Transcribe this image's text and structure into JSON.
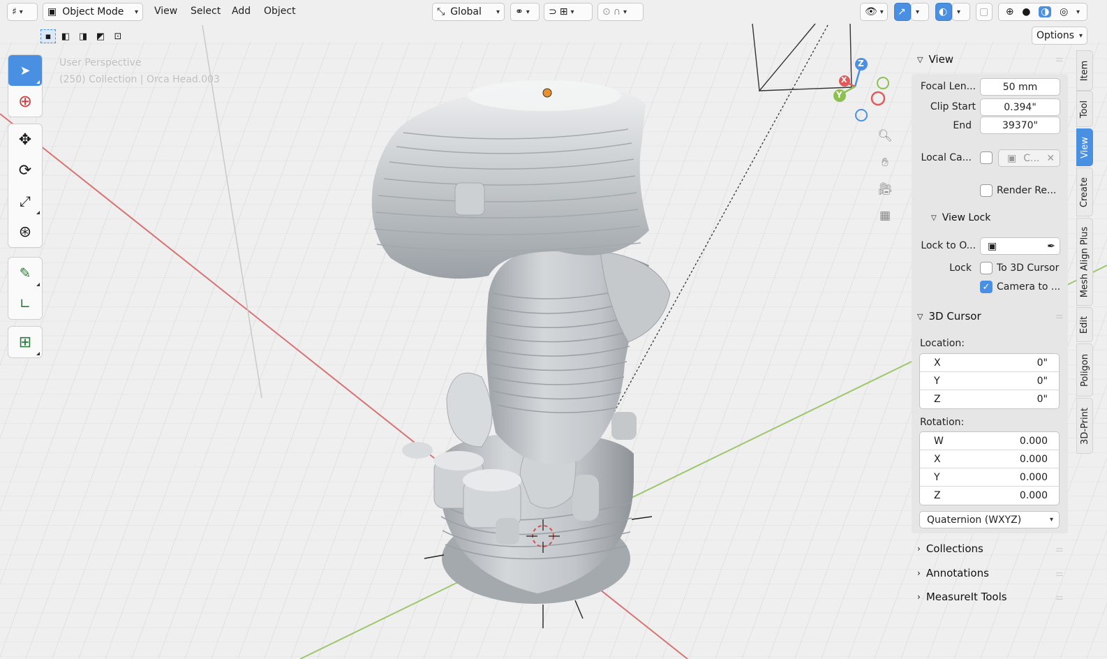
{
  "header": {
    "editor_type_icon": "grid-editor-icon",
    "mode_label": "Object Mode",
    "menus": [
      "View",
      "Select",
      "Add",
      "Object"
    ],
    "orientation_label": "Global"
  },
  "header_right": {
    "options_label": "Options"
  },
  "viewport": {
    "perspective_label": "User Perspective",
    "collection_label": "(250) Collection | Orca Head.003",
    "gizmo_axes": [
      "X",
      "Y",
      "Z"
    ],
    "colors": {
      "x_axis": "#d65a5a",
      "y_axis": "#8cc152",
      "z_axis": "#4a90e2",
      "floor": "#ededed"
    }
  },
  "sidebar": {
    "view": {
      "title": "View",
      "focal_length_label": "Focal Len...",
      "focal_length_value": "50 mm",
      "clip_start_label": "Clip Start",
      "clip_start_value": "0.394\"",
      "clip_end_label": "End",
      "clip_end_value": "39370\"",
      "local_camera_label": "Local Ca...",
      "local_camera_value": "C...",
      "render_region_label": "Render Re...",
      "view_lock": {
        "title": "View Lock",
        "lock_to_object_label": "Lock to O...",
        "lock_label": "Lock",
        "to_3d_cursor_label": "To 3D Cursor",
        "camera_to_view_label": "Camera to ..."
      }
    },
    "cursor": {
      "title": "3D Cursor",
      "location_label": "Location:",
      "location": [
        {
          "axis": "X",
          "value": "0\""
        },
        {
          "axis": "Y",
          "value": "0\""
        },
        {
          "axis": "Z",
          "value": "0\""
        }
      ],
      "rotation_label": "Rotation:",
      "rotation": [
        {
          "axis": "W",
          "value": "0.000"
        },
        {
          "axis": "X",
          "value": "0.000"
        },
        {
          "axis": "Y",
          "value": "0.000"
        },
        {
          "axis": "Z",
          "value": "0.000"
        }
      ],
      "rotation_mode": "Quaternion (WXYZ)"
    },
    "collapsed_sections": [
      "Collections",
      "Annotations",
      "MeasureIt Tools"
    ]
  },
  "tabs": [
    {
      "label": "Item",
      "active": false
    },
    {
      "label": "Tool",
      "active": false
    },
    {
      "label": "View",
      "active": true
    },
    {
      "label": "Create",
      "active": false
    },
    {
      "label": "Mesh Align Plus",
      "active": false
    },
    {
      "label": "Edit",
      "active": false
    },
    {
      "label": "Poligon",
      "active": false
    },
    {
      "label": "3D-Print",
      "active": false
    }
  ]
}
